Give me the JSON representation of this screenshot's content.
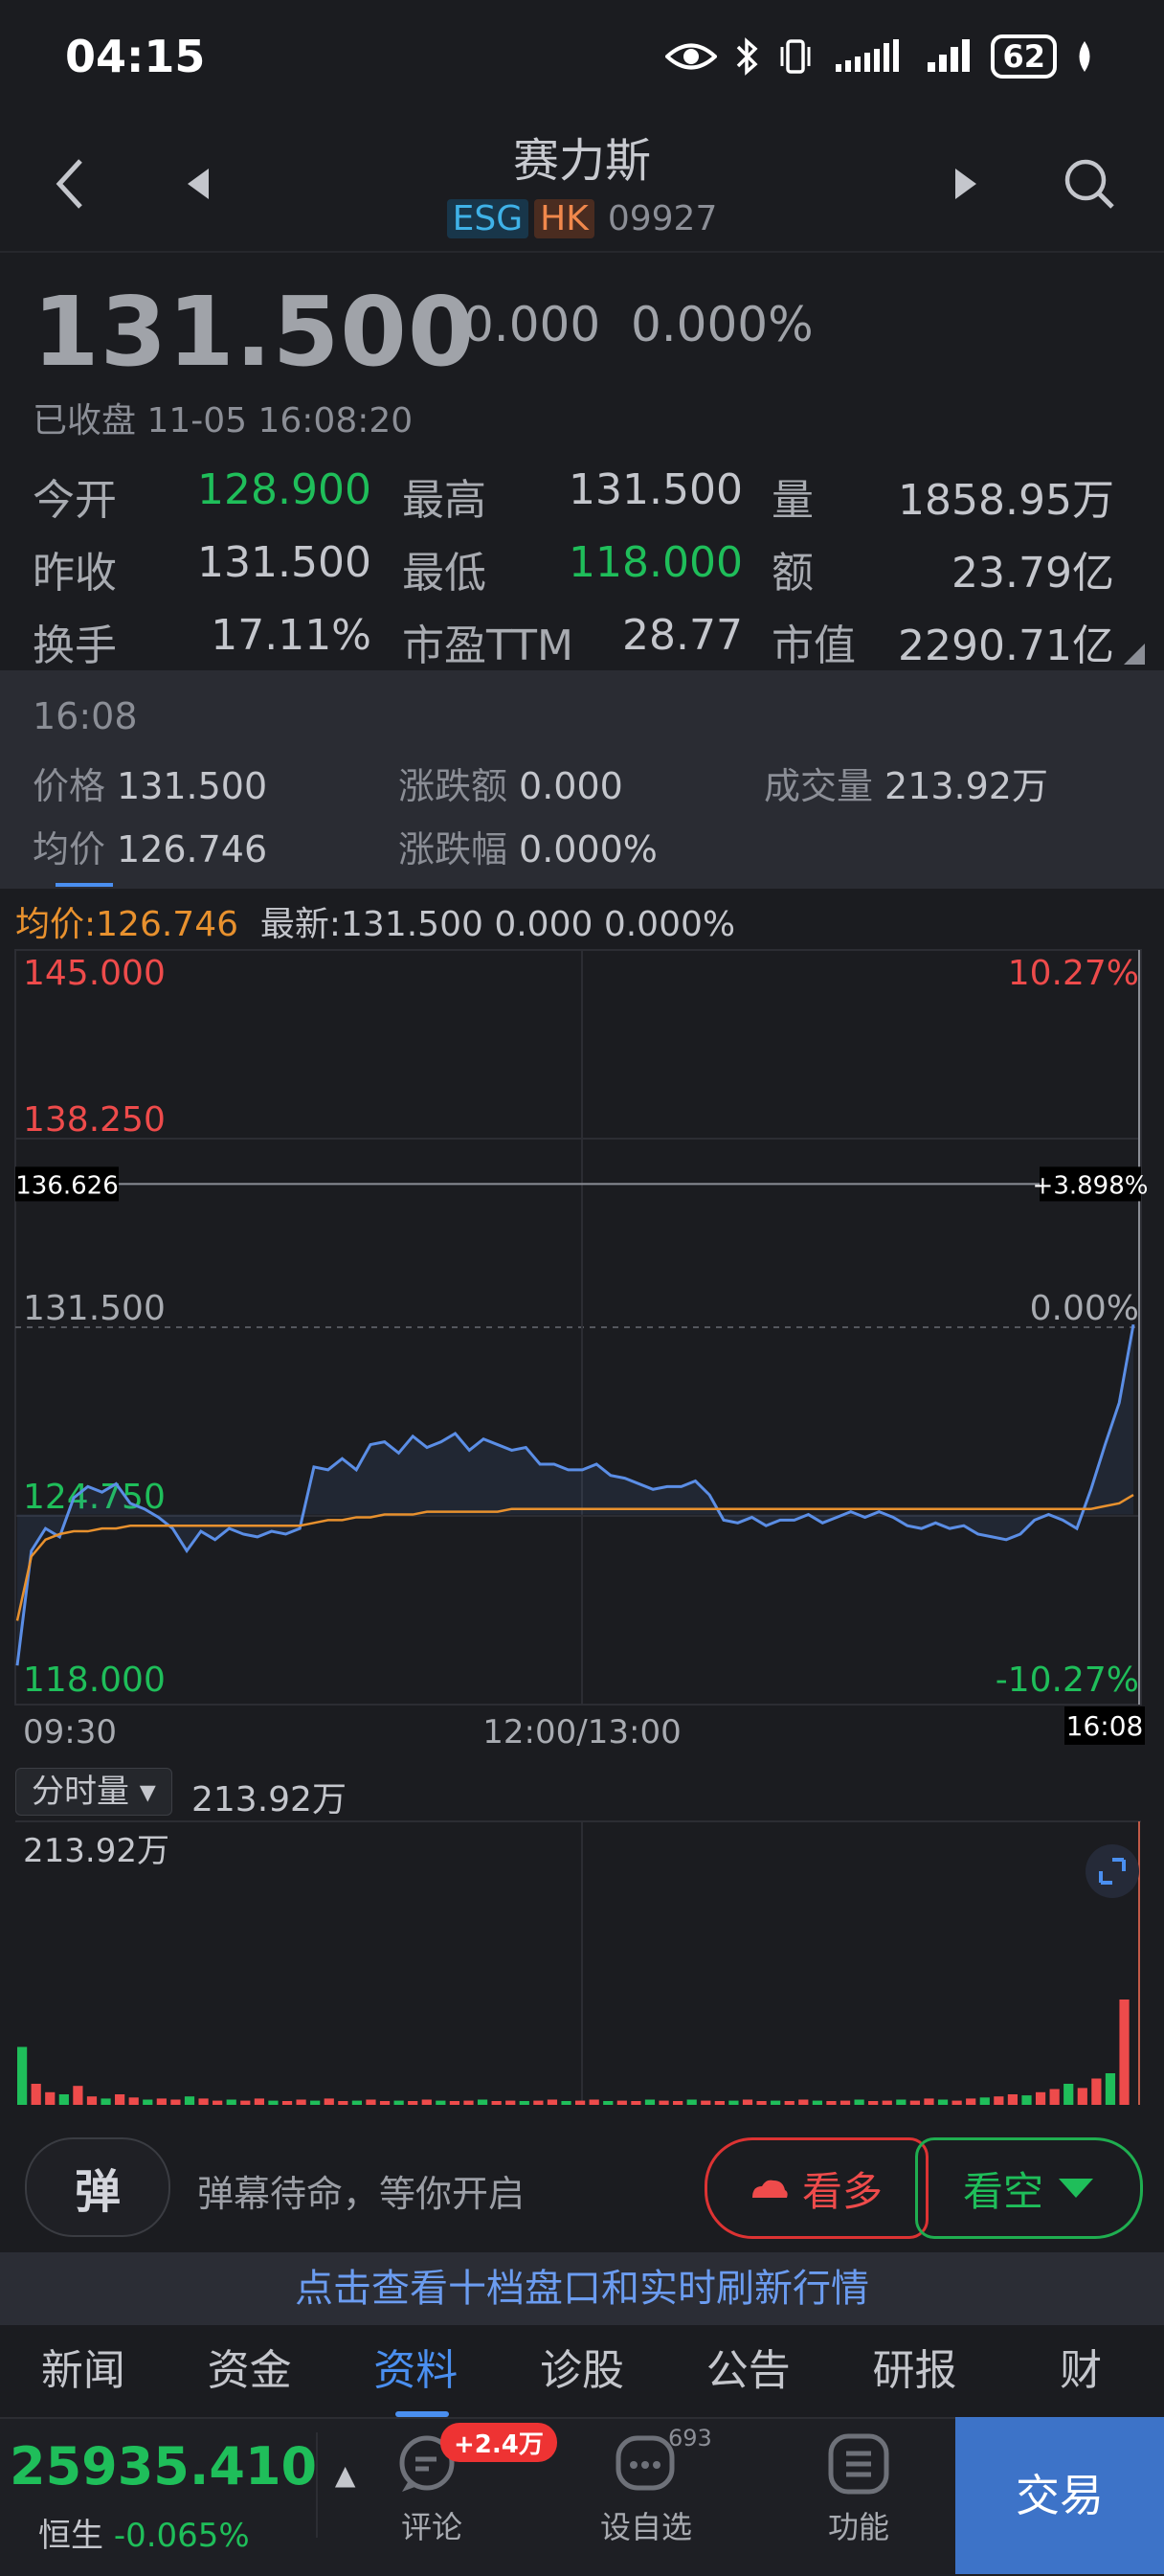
{
  "status_bar": {
    "time": "04:15",
    "battery": "62"
  },
  "header": {
    "title": "赛力斯",
    "tag_esg": "ESG",
    "tag_hk": "HK",
    "code": "09927"
  },
  "quote": {
    "price": "131.500",
    "change": "0.000",
    "change_pct": "0.000%",
    "status": "已收盘 11-05 16:08:20",
    "stats": [
      {
        "label": "今开",
        "value": "128.900",
        "color": "green"
      },
      {
        "label": "最高",
        "value": "131.500",
        "color": "neutral"
      },
      {
        "label": "量",
        "value": "1858.95万",
        "color": "neutral"
      },
      {
        "label": "昨收",
        "value": "131.500",
        "color": "neutral"
      },
      {
        "label": "最低",
        "value": "118.000",
        "color": "green"
      },
      {
        "label": "额",
        "value": "23.79亿",
        "color": "neutral"
      },
      {
        "label": "换手",
        "value": "17.11%",
        "color": "neutral"
      },
      {
        "label": "市盈TTM",
        "value": "28.77",
        "color": "neutral"
      },
      {
        "label": "市值",
        "value": "2290.71亿",
        "color": "neutral"
      }
    ]
  },
  "detail_panel": {
    "time": "16:08",
    "price_label": "价格",
    "price": "131.500",
    "chg_amt_label": "涨跌额",
    "chg_amt": "0.000",
    "vol_label": "成交量",
    "vol": "213.92万",
    "avg_label": "均价",
    "avg": "126.746",
    "chg_pct_label": "涨跌幅",
    "chg_pct": "0.000%"
  },
  "chart_legend": {
    "avg": "均价:126.746",
    "latest": "最新:131.500  0.000  0.000%"
  },
  "chart_data": {
    "type": "line",
    "y_left_ticks": [
      "145.000",
      "138.250",
      "131.500",
      "124.750",
      "118.000"
    ],
    "y_right_ticks": [
      "10.27%",
      "",
      "0.00%",
      "",
      "-10.27%"
    ],
    "ylim": [
      118.0,
      145.0
    ],
    "crosshair": {
      "price": "136.626",
      "pct": "+3.898%"
    },
    "x_ticks": [
      "09:30",
      "12:00/13:00",
      "16:08"
    ],
    "series": [
      {
        "name": "价格",
        "color": "#5b8ee6",
        "values": [
          119.4,
          123.5,
          124.3,
          124.0,
          125.4,
          125.8,
          125.6,
          125.9,
          125.2,
          125.0,
          124.7,
          124.3,
          123.5,
          124.2,
          123.9,
          124.3,
          124.1,
          124.0,
          124.2,
          124.1,
          124.3,
          126.5,
          126.4,
          126.8,
          126.4,
          127.3,
          127.4,
          127.0,
          127.6,
          127.2,
          127.4,
          127.7,
          127.1,
          127.5,
          127.3,
          127.1,
          127.2,
          126.6,
          126.6,
          126.4,
          126.4,
          126.6,
          126.2,
          126.1,
          125.9,
          125.7,
          125.8,
          125.8,
          126.0,
          125.5,
          124.6,
          124.5,
          124.7,
          124.4,
          124.6,
          124.6,
          124.8,
          124.5,
          124.7,
          124.9,
          124.7,
          124.9,
          124.7,
          124.4,
          124.3,
          124.5,
          124.3,
          124.4,
          124.1,
          124.0,
          123.9,
          124.1,
          124.6,
          124.8,
          124.6,
          124.3,
          125.7,
          127.3,
          128.8,
          131.6
        ]
      },
      {
        "name": "均价",
        "color": "#e8912e",
        "values": [
          121.0,
          123.3,
          123.9,
          124.1,
          124.2,
          124.2,
          124.3,
          124.3,
          124.4,
          124.4,
          124.4,
          124.4,
          124.4,
          124.4,
          124.4,
          124.4,
          124.4,
          124.4,
          124.4,
          124.4,
          124.4,
          124.5,
          124.6,
          124.6,
          124.7,
          124.7,
          124.8,
          124.8,
          124.8,
          124.9,
          124.9,
          124.9,
          124.9,
          124.9,
          124.9,
          125.0,
          125.0,
          125.0,
          125.0,
          125.0,
          125.0,
          125.0,
          125.0,
          125.0,
          125.0,
          125.0,
          125.0,
          125.0,
          125.0,
          125.0,
          125.0,
          125.0,
          125.0,
          125.0,
          125.0,
          125.0,
          125.0,
          125.0,
          125.0,
          125.0,
          125.0,
          125.0,
          125.0,
          125.0,
          125.0,
          125.0,
          125.0,
          125.0,
          125.0,
          125.0,
          125.0,
          125.0,
          125.0,
          125.0,
          125.0,
          125.0,
          125.0,
          125.1,
          125.2,
          125.5
        ]
      }
    ]
  },
  "volume": {
    "selector": "分时量",
    "total": "213.92万",
    "max_label": "213.92万",
    "bars": [
      0.55,
      0.2,
      0.12,
      0.1,
      0.18,
      0.08,
      0.06,
      0.1,
      0.07,
      0.05,
      0.06,
      0.05,
      0.08,
      0.06,
      0.04,
      0.05,
      0.04,
      0.06,
      0.04,
      0.03,
      0.05,
      0.04,
      0.06,
      0.03,
      0.04,
      0.05,
      0.03,
      0.04,
      0.03,
      0.05,
      0.04,
      0.03,
      0.04,
      0.05,
      0.03,
      0.04,
      0.03,
      0.04,
      0.05,
      0.03,
      0.04,
      0.05,
      0.03,
      0.04,
      0.03,
      0.05,
      0.04,
      0.03,
      0.05,
      0.04,
      0.03,
      0.04,
      0.05,
      0.03,
      0.04,
      0.03,
      0.05,
      0.04,
      0.03,
      0.04,
      0.05,
      0.03,
      0.04,
      0.05,
      0.04,
      0.06,
      0.05,
      0.04,
      0.06,
      0.07,
      0.08,
      0.1,
      0.09,
      0.12,
      0.15,
      0.2,
      0.16,
      0.25,
      0.3,
      1.0
    ]
  },
  "bottom_bar": {
    "danmu_icon": "弹",
    "danmu_text": "弹幕待命，等你开启",
    "bull": "看多",
    "bear": "看空",
    "banner": "点击查看十档盘口和实时刷新行情",
    "tabs": [
      "新闻",
      "资金",
      "资料",
      "诊股",
      "公告",
      "研报",
      "财"
    ],
    "active_tab": 2
  },
  "footer": {
    "index_value": "25935.410",
    "index_name": "恒生",
    "index_change": "-0.065%",
    "comment_label": "评论",
    "comment_badge": "+2.4万",
    "watch_label": "设自选",
    "watch_count": "693",
    "func_label": "功能",
    "trade_label": "交易"
  },
  "colors": {
    "bg": "#1b1c20",
    "green": "#1fbe5a",
    "red": "#ee4b4b",
    "blue": "#4a8ff0",
    "avg_line": "#e8912e",
    "price_line": "#5b8ee6"
  }
}
